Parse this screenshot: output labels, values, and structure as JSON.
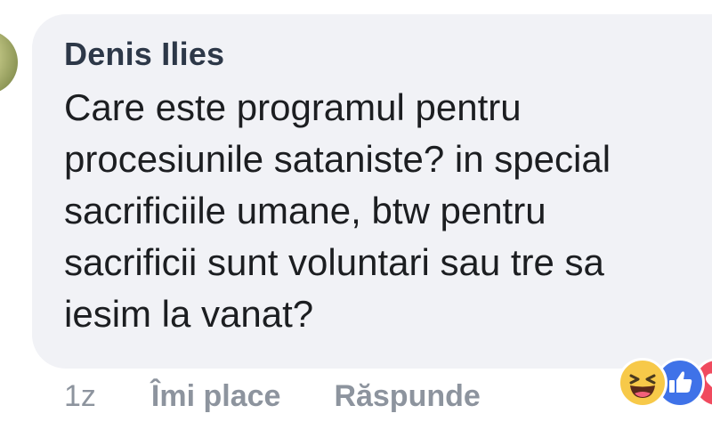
{
  "comment": {
    "author": "Denis Ilies",
    "text_lines": [
      "Care este programul pentru",
      "procesiunile sataniste? in special",
      "sacrificiile umane, btw pentru",
      "sacrificii sunt voluntari sau tre sa",
      "iesim la vanat?"
    ]
  },
  "actions": {
    "timestamp": "1z",
    "like_label": "Îmi place",
    "reply_label": "Răspunde"
  },
  "reactions": [
    "haha-icon",
    "like-icon",
    "love-icon"
  ],
  "colors": {
    "bubble": "#f1f2f6",
    "author": "#2d3848",
    "text": "#1c1e21",
    "muted": "#8d949e",
    "like": "#3f72e8",
    "haha": "#f7c949",
    "love": "#f04a5e"
  }
}
